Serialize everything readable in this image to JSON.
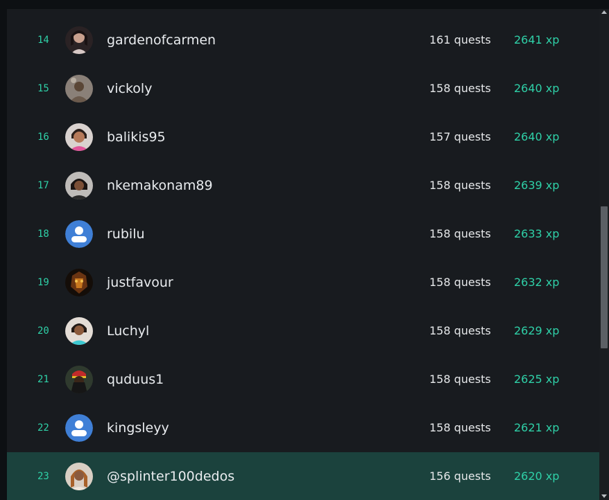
{
  "leaderboard": {
    "rows": [
      {
        "rank": "14",
        "username": "gardenofcarmen",
        "quests": "161 quests",
        "xp": "2641 xp",
        "avatar": "user-photo",
        "highlighted": false
      },
      {
        "rank": "15",
        "username": "vickoly",
        "quests": "158 quests",
        "xp": "2640 xp",
        "avatar": "user-photo",
        "highlighted": false
      },
      {
        "rank": "16",
        "username": "balikis95",
        "quests": "157 quests",
        "xp": "2640 xp",
        "avatar": "user-photo",
        "highlighted": false
      },
      {
        "rank": "17",
        "username": "nkemakonam89",
        "quests": "158 quests",
        "xp": "2639 xp",
        "avatar": "user-photo",
        "highlighted": false
      },
      {
        "rank": "18",
        "username": "rubilu",
        "quests": "158 quests",
        "xp": "2633 xp",
        "avatar": "default-user-icon",
        "highlighted": false
      },
      {
        "rank": "19",
        "username": "justfavour",
        "quests": "158 quests",
        "xp": "2632 xp",
        "avatar": "user-photo",
        "highlighted": false
      },
      {
        "rank": "20",
        "username": "Luchyl",
        "quests": "158 quests",
        "xp": "2629 xp",
        "avatar": "user-photo",
        "highlighted": false
      },
      {
        "rank": "21",
        "username": "quduus1",
        "quests": "158 quests",
        "xp": "2625 xp",
        "avatar": "user-photo",
        "highlighted": false
      },
      {
        "rank": "22",
        "username": "kingsleyy",
        "quests": "158 quests",
        "xp": "2621 xp",
        "avatar": "default-user-icon",
        "highlighted": false
      },
      {
        "rank": "23",
        "username": "@splinter100dedos",
        "quests": "156 quests",
        "xp": "2620 xp",
        "avatar": "user-photo",
        "highlighted": true
      }
    ]
  },
  "colors": {
    "accent": "#2fd1a8",
    "panel_bg": "#181b1f",
    "highlight_bg": "#1b423d",
    "default_avatar_bg": "#3f7fd6"
  }
}
